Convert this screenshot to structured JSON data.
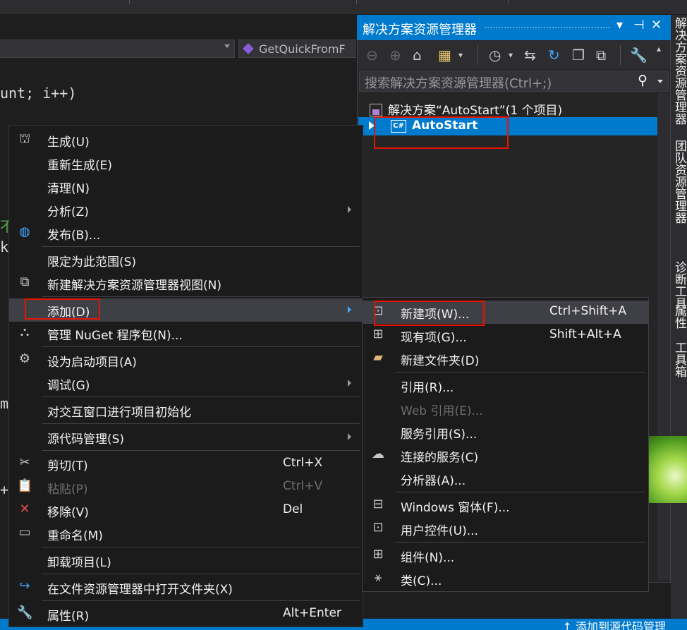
{
  "editor": {
    "nav_member": "GetQuickFromF",
    "code_line1": "unt; i++)",
    "code_frag_green": "不",
    "code_frag_k": "k",
    "code_frag_m": "m",
    "code_frag_plus": "+"
  },
  "solution_explorer": {
    "title": "解决方案资源管理器",
    "title_buttons": [
      "▾",
      "⊣",
      "✕"
    ],
    "search_placeholder": "搜索解决方案资源管理器(Ctrl+;)",
    "solution_label": "解决方案“AutoStart”(1 个项目)",
    "project_label": "AutoStart",
    "project_icon_text": "C#"
  },
  "right_tabs": [
    "解决方案资源管理器",
    "团队资源管理器",
    "诊断工具",
    "属性",
    "工具箱"
  ],
  "status_bar": {
    "text": "↑  添加到源代码管理"
  },
  "context_menu": {
    "items": [
      {
        "label": "生成(U)",
        "icon": "build-icon"
      },
      {
        "label": "重新生成(E)"
      },
      {
        "label": "清理(N)"
      },
      {
        "label": "分析(Z)",
        "submenu": true
      },
      {
        "label": "发布(B)...",
        "icon": "globe-icon"
      },
      {
        "label": "限定为此范围(S)"
      },
      {
        "label": "新建解决方案资源管理器视图(N)",
        "icon": "new-view-icon"
      },
      {
        "label": "添加(D)",
        "submenu": true,
        "highlighted": true
      },
      {
        "label": "管理 NuGet 程序包(N)...",
        "icon": "nuget-icon"
      },
      {
        "label": "设为启动项目(A)",
        "icon": "gear-icon"
      },
      {
        "label": "调试(G)",
        "submenu": true
      },
      {
        "label": "对交互窗口进行项目初始化"
      },
      {
        "label": "源代码管理(S)",
        "submenu": true
      },
      {
        "label": "剪切(T)",
        "shortcut": "Ctrl+X",
        "icon": "scissors-icon"
      },
      {
        "label": "粘贴(P)",
        "shortcut": "Ctrl+V",
        "icon": "paste-icon",
        "disabled": true
      },
      {
        "label": "移除(V)",
        "shortcut": "Del",
        "icon": "remove-icon"
      },
      {
        "label": "重命名(M)",
        "icon": "rename-icon"
      },
      {
        "label": "卸载项目(L)"
      },
      {
        "label": "在文件资源管理器中打开文件夹(X)",
        "icon": "refresh-arrow-icon"
      },
      {
        "label": "属性(R)",
        "shortcut": "Alt+Enter",
        "icon": "wrench-icon"
      }
    ]
  },
  "add_submenu": {
    "items": [
      {
        "label": "新建项(W)...",
        "shortcut": "Ctrl+Shift+A",
        "highlighted": true
      },
      {
        "label": "现有项(G)...",
        "shortcut": "Shift+Alt+A"
      },
      {
        "label": "新建文件夹(D)"
      },
      {
        "label": "引用(R)..."
      },
      {
        "label": "Web 引用(E)...",
        "disabled": true
      },
      {
        "label": "服务引用(S)..."
      },
      {
        "label": "连接的服务(C)"
      },
      {
        "label": "分析器(A)..."
      },
      {
        "label": "Windows 窗体(F)..."
      },
      {
        "label": "用户控件(U)..."
      },
      {
        "label": "组件(N)..."
      },
      {
        "label": "类(C)..."
      }
    ]
  },
  "colors": {
    "accent": "#007acc",
    "highlight_box": "#e51400",
    "menu_bg": "#1b1b1c",
    "menu_hover": "#3f3f46"
  }
}
